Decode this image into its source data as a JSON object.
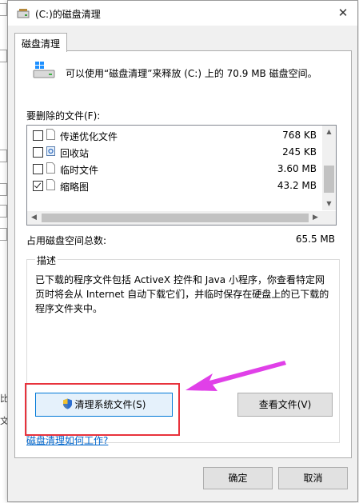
{
  "background_window": {
    "fragments": [
      "比",
      "文"
    ]
  },
  "window": {
    "title": "(C:)的磁盘清理",
    "close_glyph": "✕"
  },
  "tab": {
    "label": "磁盘清理"
  },
  "summary": "可以使用“磁盘清理”来释放 (C:) 上的 70.9 MB 磁盘空间。",
  "files_section": {
    "label": "要删除的文件(F):",
    "items": [
      {
        "name": "传递优化文件",
        "size": "768 KB",
        "checked": false,
        "icon": "file-icon"
      },
      {
        "name": "回收站",
        "size": "245 KB",
        "checked": false,
        "icon": "recycle-bin-icon"
      },
      {
        "name": "临时文件",
        "size": "3.60 MB",
        "checked": false,
        "icon": "file-icon"
      },
      {
        "name": "缩略图",
        "size": "43.2 MB",
        "checked": true,
        "icon": "file-icon"
      }
    ]
  },
  "total": {
    "label": "占用磁盘空间总数:",
    "value": "65.5 MB"
  },
  "description": {
    "legend": "描述",
    "text": "已下载的程序文件包括 ActiveX 控件和 Java 小程序，你查看特定网页时将会从 Internet 自动下载它们，并临时保存在硬盘上的已下载的程序文件夹中。"
  },
  "buttons": {
    "cleanup_system": "清理系统文件(S)",
    "view_files": "查看文件(V)",
    "ok": "确定",
    "cancel": "取消"
  },
  "help_link": "磁盘清理如何工作?",
  "colors": {
    "annotation_rect": "#e8323c",
    "annotation_arrow": "#e040e8",
    "link": "#0066cc"
  }
}
